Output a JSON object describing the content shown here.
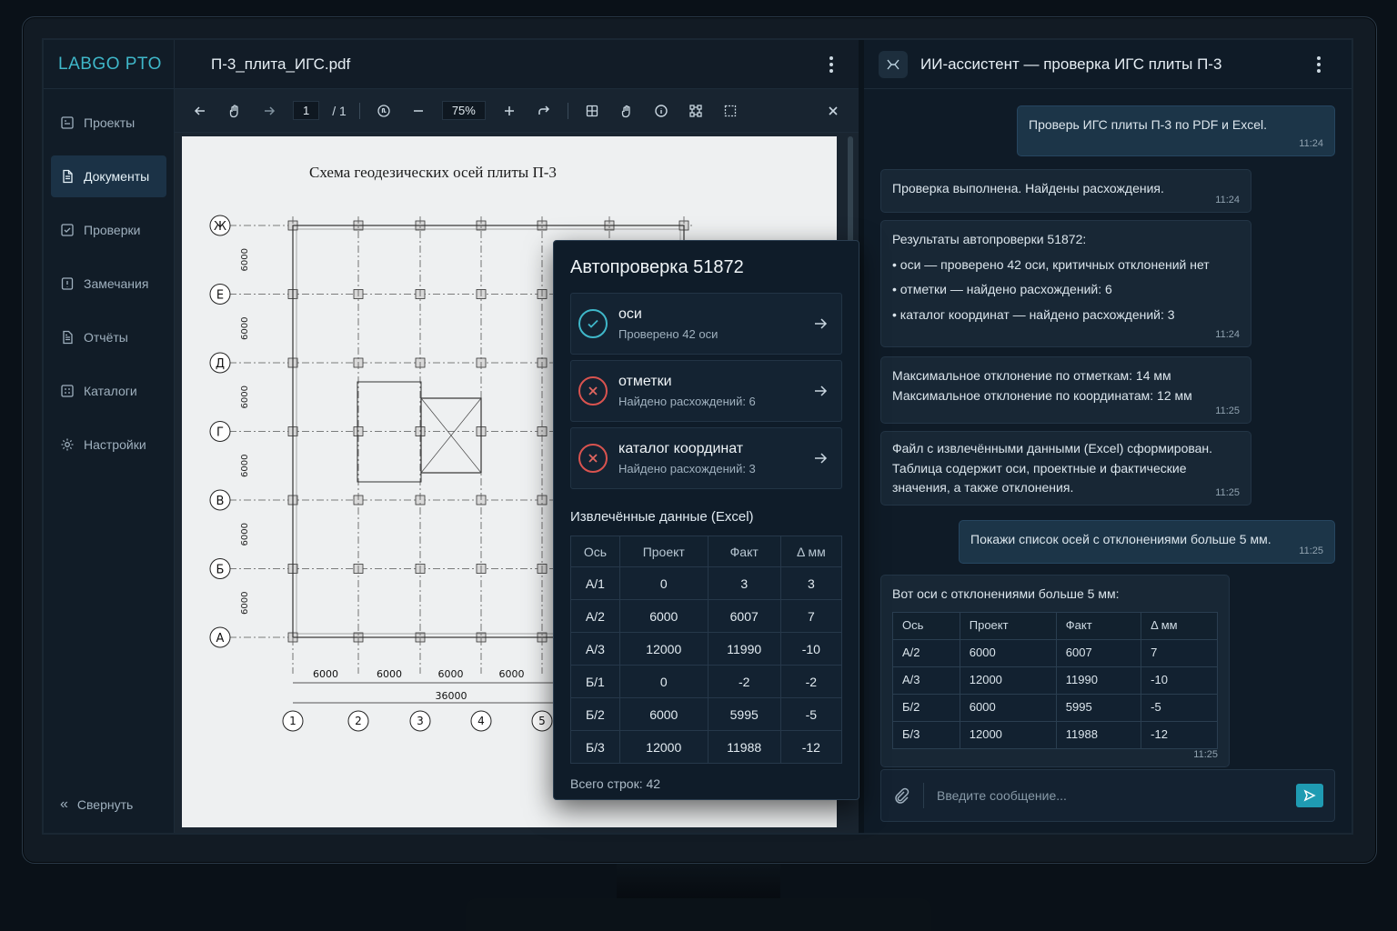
{
  "app": {
    "logo": "LABGO PTO"
  },
  "sidebar": {
    "items": [
      {
        "label": "Проекты",
        "icon": "projects-icon",
        "active": false
      },
      {
        "label": "Документы",
        "icon": "documents-icon",
        "active": true
      },
      {
        "label": "Проверки",
        "icon": "checks-icon",
        "active": false
      },
      {
        "label": "Замечания",
        "icon": "remarks-icon",
        "active": false
      },
      {
        "label": "Отчёты",
        "icon": "reports-icon",
        "active": false
      },
      {
        "label": "Каталоги",
        "icon": "catalogs-icon",
        "active": false
      },
      {
        "label": "Настройки",
        "icon": "settings-icon",
        "active": false
      }
    ],
    "collapse_label": "Свернуть"
  },
  "pdf": {
    "file_name": "П-3_плита_ИГС.pdf",
    "page_current": "1",
    "page_total": "/ 1",
    "zoom": "75%",
    "drawing": {
      "title": "Схема геодезических осей плиты П-3",
      "row_axes": [
        "Ж",
        "Е",
        "Д",
        "Г",
        "В",
        "Б",
        "А"
      ],
      "row_spacing": "6000",
      "col_axes": [
        "1",
        "2",
        "3",
        "4",
        "5"
      ],
      "col_spacing": "6000",
      "total_length": "36000"
    }
  },
  "autocheck": {
    "title": "Автопроверка 51872",
    "items": [
      {
        "name": "оси",
        "summary": "Проверено 42 оси",
        "status": "ok"
      },
      {
        "name": "отметки",
        "summary": "Найдено расхождений: 6",
        "status": "error"
      },
      {
        "name": "каталог координат",
        "summary": "Найдено расхождений: 3",
        "status": "error"
      }
    ],
    "extracted_title": "Извлечённые данные (Excel)",
    "table": {
      "headers": [
        "Ось",
        "Проект",
        "Факт",
        "Δ мм"
      ],
      "rows": [
        [
          "А/1",
          "0",
          "3",
          "3"
        ],
        [
          "А/2",
          "6000",
          "6007",
          "7"
        ],
        [
          "А/3",
          "12000",
          "11990",
          "-10"
        ],
        [
          "Б/1",
          "0",
          "-2",
          "-2"
        ],
        [
          "Б/2",
          "6000",
          "5995",
          "-5"
        ],
        [
          "Б/3",
          "12000",
          "11988",
          "-12"
        ]
      ]
    },
    "total_rows": "Всего строк: 42"
  },
  "chat": {
    "title": "ИИ-ассистент — проверка ИГС плиты П-3",
    "messages": [
      {
        "role": "user",
        "text": "Проверь ИГС плиты П-3 по PDF и Excel.",
        "time": "11:24"
      },
      {
        "role": "assistant",
        "text": "Проверка выполнена. Найдены расхождения.",
        "time": "11:24"
      },
      {
        "role": "assistant",
        "text": "Результаты автопроверки 51872:",
        "bullets": [
          "оси — проверено 42 оси, критичных отклонений нет",
          "отметки — найдено расхождений: 6",
          "каталог координат — найдено расхождений:  3"
        ],
        "time": "11:24"
      },
      {
        "role": "assistant",
        "lines": [
          "Максимальное отклонение по отметкам: 14 мм",
          "Максимальное отклонение по координатам: 12 мм"
        ],
        "time": "11:25"
      },
      {
        "role": "assistant",
        "lines": [
          "Файл с извлечёнными данными (Excel) сформирован.",
          "Таблица содержит оси, проектные и фактические",
          "значения, а также отклонения."
        ],
        "time": "11:25"
      },
      {
        "role": "user",
        "text": "Покажи список осей с отклонениями больше 5 мм.",
        "time": "11:25"
      },
      {
        "role": "assistant",
        "text": "Вот оси с отклонениями больше 5 мм:",
        "time": "11:25",
        "table": {
          "headers": [
            "Ось",
            "Проект",
            "Факт",
            "Δ мм"
          ],
          "rows": [
            [
              "А/2",
              "6000",
              "6007",
              "7"
            ],
            [
              "А/3",
              "12000",
              "11990",
              "-10"
            ],
            [
              "Б/2",
              "6000",
              "5995",
              "-5"
            ],
            [
              "Б/3",
              "12000",
              "11988",
              "-12"
            ]
          ]
        }
      }
    ],
    "input_placeholder": "Введите сообщение..."
  },
  "colors": {
    "accent": "#3fb7c9",
    "error": "#d9534f",
    "send": "#1f9bb2"
  }
}
